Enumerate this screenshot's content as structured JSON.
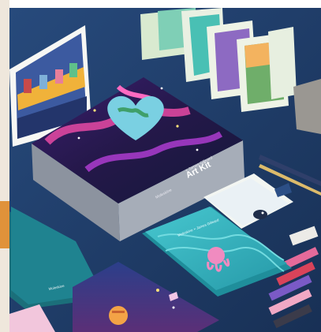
{
  "image": {
    "alt": "",
    "colors": {
      "background": "#1f3c68",
      "box_body": "#9fa6b1",
      "box_lid_art": "#2a1a52",
      "teal_notebook": "#1d7b86",
      "cyan_notebook": "#34b6c0",
      "white_panel": "#f4f5f2",
      "cards_left": "#ffffff"
    }
  },
  "box": {
    "side_text": "Art Kit",
    "lid_text_left": "Moleskine",
    "lid_text_right": "× James Gilleard"
  },
  "notebook_teal": {
    "label": "Moleskine"
  },
  "notebook_cyan": {
    "label": "Moleskine × James Gilleard"
  }
}
